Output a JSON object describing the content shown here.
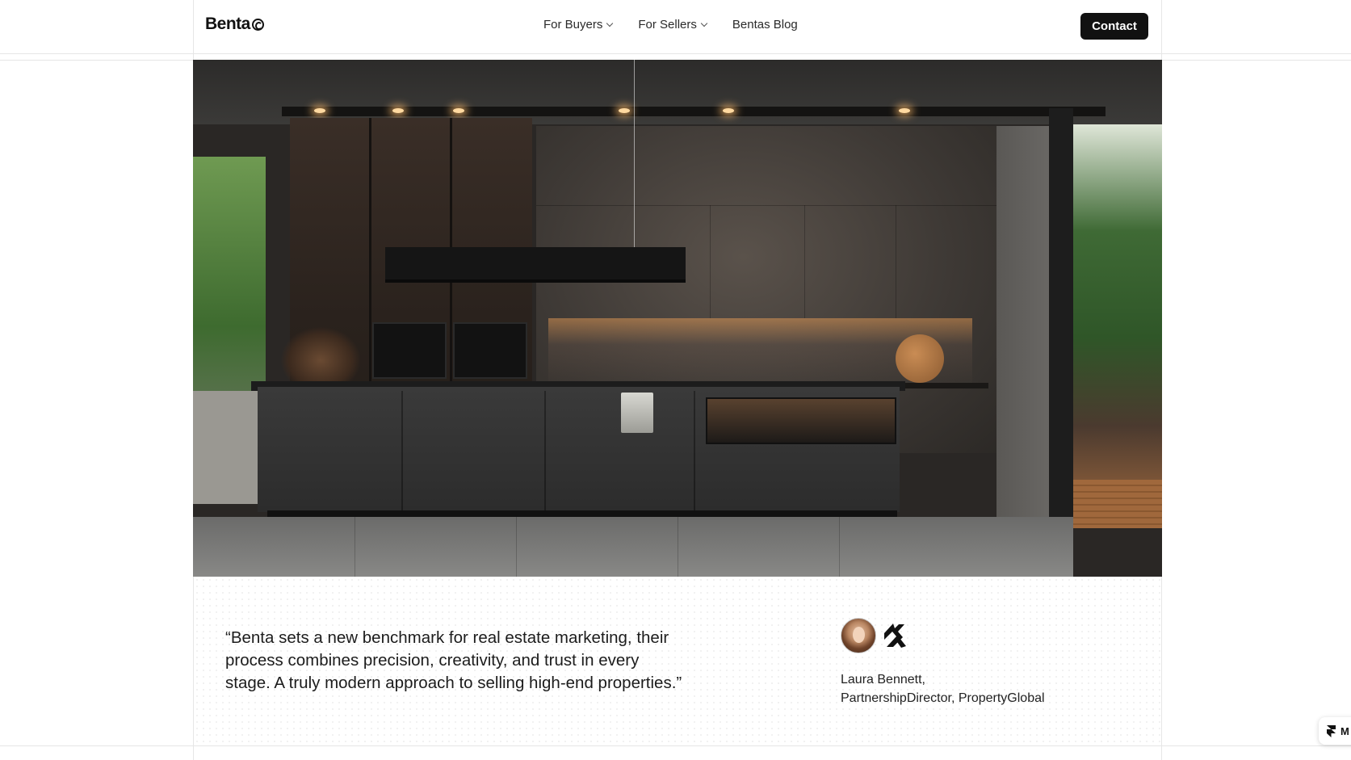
{
  "header": {
    "brand": "Benta",
    "nav": [
      {
        "label": "For Buyers",
        "has_dropdown": true
      },
      {
        "label": "For Sellers",
        "has_dropdown": true
      },
      {
        "label": "Bentas Blog",
        "has_dropdown": false
      }
    ],
    "contact_label": "Contact"
  },
  "hero": {
    "image": "modern-dark-kitchen-photo"
  },
  "testimonial": {
    "quote_line1": "“Benta sets a new benchmark for real estate marketing, their",
    "quote_line2": "process combines precision, creativity, and trust in every",
    "quote_line3": "stage. A truly modern approach to selling high-end properties.”",
    "author_name": "Laura Bennett,",
    "author_title": "PartnershipDirector, PropertyGlobal",
    "avatar_icon": "avatar-portrait",
    "company_icon": "company-logo-icon"
  },
  "badge": {
    "label": "M",
    "icon": "framer-icon"
  },
  "colors": {
    "background": "#ffffff",
    "button": "#111111",
    "text": "#1c1c1c",
    "guide_lines": "#e6e6e6"
  }
}
